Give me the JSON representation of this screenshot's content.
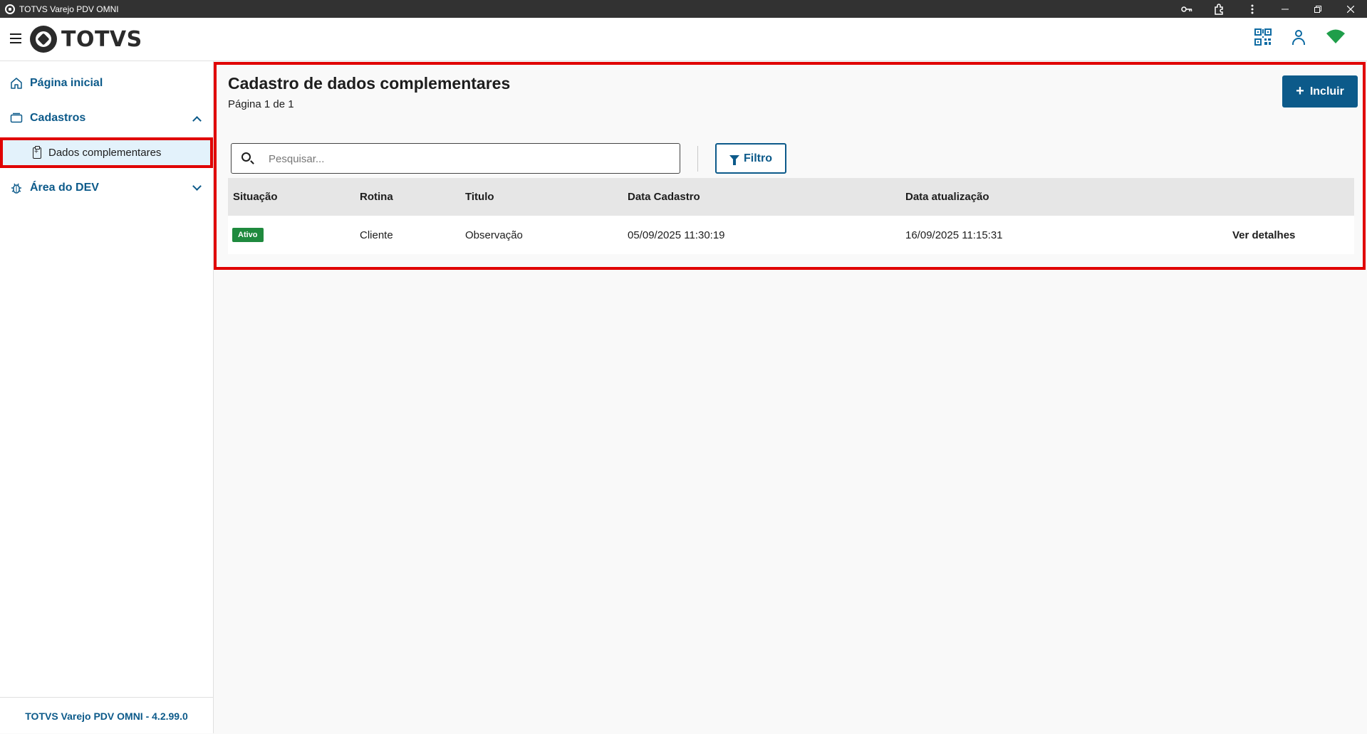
{
  "window": {
    "title": "TOTVS Varejo PDV OMNI",
    "controls": [
      "key-icon",
      "extension-icon",
      "more-vert-icon",
      "minimize",
      "restore",
      "close"
    ]
  },
  "header": {
    "logo_text": "TOTVS",
    "icons": [
      "qr-code-icon",
      "user-icon",
      "wifi-icon"
    ],
    "wifi_color": "#1f9e4a"
  },
  "sidebar": {
    "items": [
      {
        "label": "Página inicial",
        "icon": "home-icon"
      },
      {
        "label": "Cadastros",
        "icon": "folder-icon",
        "expanded": true
      },
      {
        "label": "Dados complementares",
        "icon": "clipboard-icon",
        "selected": true
      },
      {
        "label": "Área do DEV",
        "icon": "bug-icon",
        "expanded": false
      }
    ],
    "footer": "TOTVS Varejo PDV OMNI - 4.2.99.0"
  },
  "main": {
    "title": "Cadastro de dados complementares",
    "subtitle": "Página 1 de 1",
    "add_button": "Incluir",
    "search_placeholder": "Pesquisar...",
    "filter_button": "Filtro",
    "table": {
      "headers": [
        "Situação",
        "Rotina",
        "Titulo",
        "Data Cadastro",
        "Data atualização",
        ""
      ],
      "rows": [
        {
          "status": "Ativo",
          "rotina": "Cliente",
          "titulo": "Observação",
          "data_cadastro": "05/09/2025 11:30:19",
          "data_atualizacao": "16/09/2025 11:15:31",
          "action": "Ver detalhes"
        }
      ]
    }
  },
  "colors": {
    "brand": "#0c5a8a",
    "status_active": "#1f8a3e",
    "highlight": "#e00000"
  }
}
